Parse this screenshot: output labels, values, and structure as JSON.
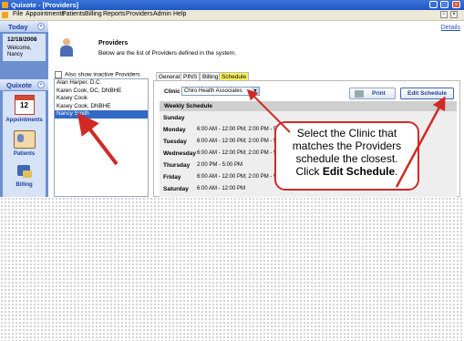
{
  "window": {
    "title": "Quixote - [Providers]"
  },
  "menu": [
    "File",
    "Appointments",
    "Patients",
    "Billing",
    "Reports",
    "Providers",
    "Admin",
    "Help"
  ],
  "subbar": {
    "details_link": "Details"
  },
  "today": {
    "header": "Today",
    "date": "12/18/2008",
    "welcome": "Welcome,",
    "user": "Nancy"
  },
  "quixote": {
    "header": "Quixote",
    "items": [
      {
        "label": "Appointments",
        "icon": "calendar-icon",
        "day": "12"
      },
      {
        "label": "Patients",
        "icon": "patients-icon"
      },
      {
        "label": "Billing",
        "icon": "billing-icon"
      }
    ]
  },
  "providers": {
    "title": "Providers",
    "subtitle": "Below are the list of Providers defined in the system.",
    "inactive_label": "Also show inactive Providers",
    "list": [
      "Alan Harper, D.C.",
      "Karen Cook, DC, DNBHE",
      "Kasey Cook",
      "Kasey Cook, DNBHE",
      "Nancy Smith"
    ],
    "selected_index": 4
  },
  "tabs": [
    {
      "label": "General"
    },
    {
      "label": "PINS"
    },
    {
      "label": "Billing"
    },
    {
      "label": "Schedule",
      "active": true
    }
  ],
  "schedule": {
    "clinic_label": "Clinic",
    "clinic_value": "Chiro Health Associates",
    "print_label": "Print",
    "edit_label": "Edit Schedule",
    "header": "Weekly Schedule",
    "rows": [
      {
        "day": "Sunday",
        "hours": ""
      },
      {
        "day": "Monday",
        "hours": "6:00 AM - 12:00 PM; 2:00 PM - 5:00 PM"
      },
      {
        "day": "Tuesday",
        "hours": "6:00 AM - 12:00 PM; 2:00 PM - 5:00 PM"
      },
      {
        "day": "Wednesday",
        "hours": "6:00 AM - 12:00 PM; 2:00 PM - 5:00 PM"
      },
      {
        "day": "Thursday",
        "hours": "2:00 PM - 5:00 PM"
      },
      {
        "day": "Friday",
        "hours": "6:00 AM - 12:00 PM; 2:00 PM - 5:00 PM"
      },
      {
        "day": "Saturday",
        "hours": "6:00 AM - 12:00 PM"
      }
    ]
  },
  "callout": {
    "text_line1": "Select the Clinic that",
    "text_line2": "matches the Providers",
    "text_line3": "schedule the closest.",
    "text_prefix": "Click ",
    "text_bold": "Edit Schedule",
    "text_suffix": "."
  },
  "colors": {
    "selection": "#316ac5",
    "active_tab": "#f7f05e",
    "annotation_red": "#d12a26"
  }
}
